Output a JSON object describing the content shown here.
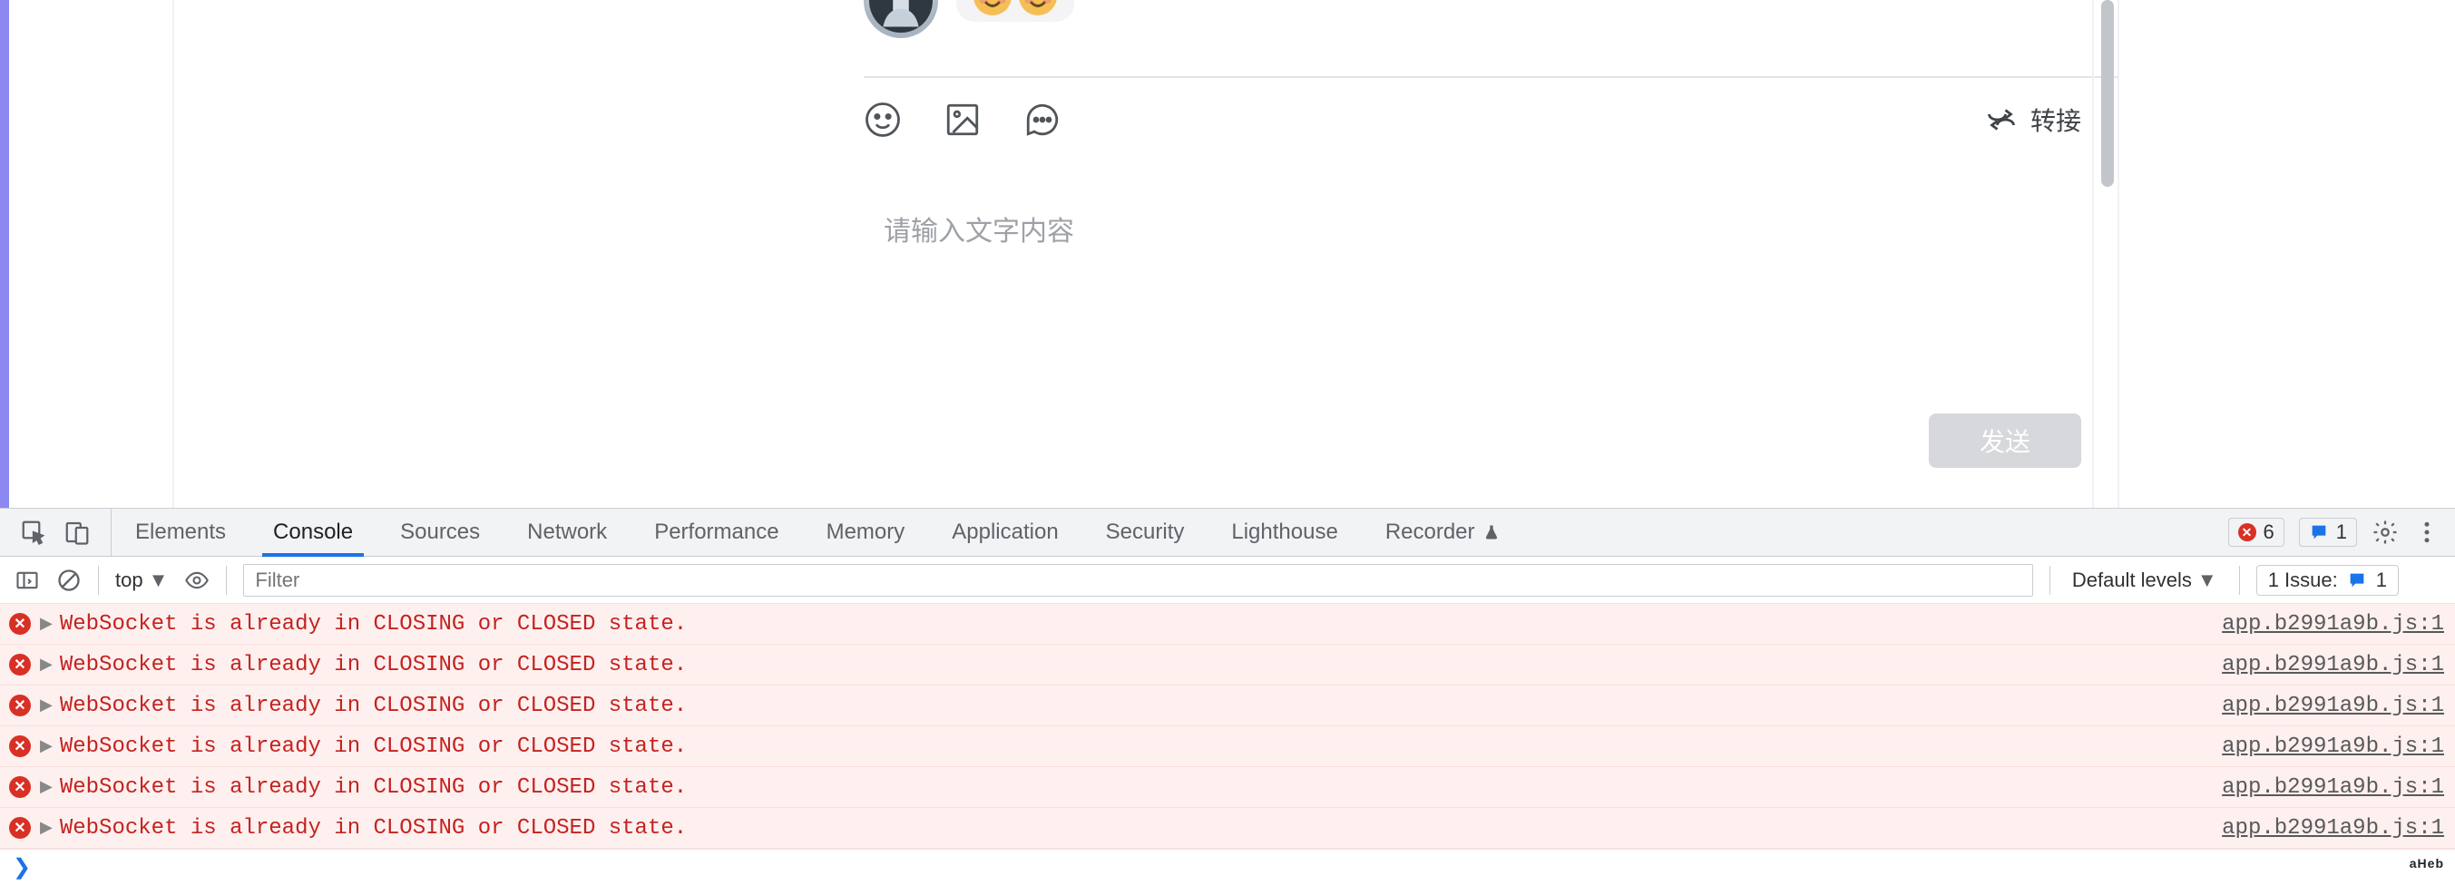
{
  "chat": {
    "emoji_count": 2,
    "forward_label": "转接",
    "placeholder": "请输入文字内容",
    "send_label": "发送"
  },
  "devtools": {
    "tabs": [
      "Elements",
      "Console",
      "Sources",
      "Network",
      "Performance",
      "Memory",
      "Application",
      "Security",
      "Lighthouse",
      "Recorder"
    ],
    "active_tab": "Console",
    "error_count": "6",
    "info_count": "1",
    "context_label": "top",
    "filter_placeholder": "Filter",
    "levels_label": "Default levels",
    "issues_label": "1 Issue:",
    "issues_count": "1",
    "prompt": "❯",
    "log": {
      "message": "WebSocket is already in CLOSING or CLOSED state.",
      "source": "app.b2991a9b.js:1",
      "count": 6
    }
  },
  "branding": "aHeb"
}
